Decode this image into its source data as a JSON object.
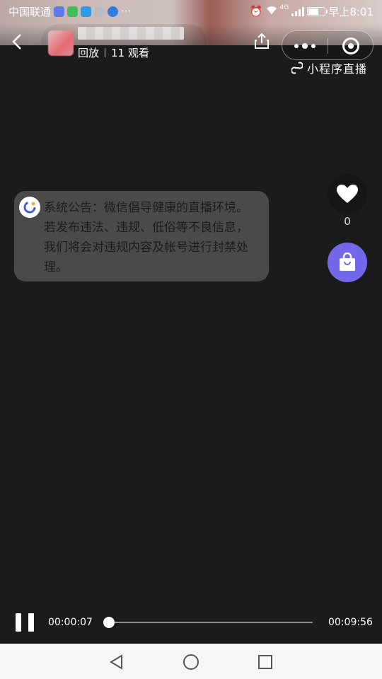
{
  "status_bar": {
    "carrier": "中国联通",
    "network": "4G",
    "time": "早上8:01"
  },
  "header": {
    "replay_label": "回放",
    "viewers": "11 观看",
    "mini_program_label": "小程序直播"
  },
  "notice": {
    "text": "系统公告：微信倡导健康的直播环境。若发布违法、违规、低俗等不良信息，我们将会对违规内容及帐号进行封禁处理。"
  },
  "side_actions": {
    "like_count": "0"
  },
  "player": {
    "current_time": "00:00:07",
    "total_time": "00:09:56",
    "progress": 0.012
  },
  "colors": {
    "background": "#1b1b1c",
    "shop_button": "#7567e9",
    "notice_bg": "#4a4a4b",
    "nav_bar": "#f6f6f6"
  },
  "icons": [
    "back-icon",
    "share-icon",
    "more-icon",
    "close-mini-program-icon",
    "link-icon",
    "announcement-icon",
    "heart-icon",
    "shopping-bag-icon",
    "pause-icon",
    "nav-back-icon",
    "nav-home-icon",
    "nav-recents-icon"
  ]
}
